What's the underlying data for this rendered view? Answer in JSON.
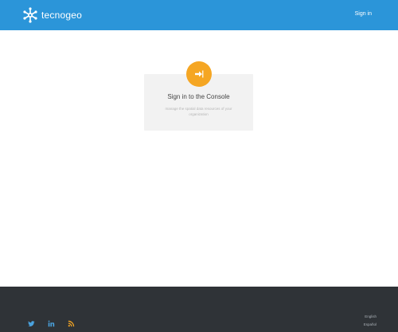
{
  "header": {
    "brand": "tecnogeo",
    "signin_link": "Sign in"
  },
  "card": {
    "title": "Sign in to the Console",
    "subtitle": "manage the spatial data resources of your organization"
  },
  "footer": {
    "social": [
      "twitter-icon",
      "linkedin-icon",
      "rss-icon"
    ],
    "languages": [
      "English",
      "Español"
    ]
  },
  "colors": {
    "header_bg": "#2b95d9",
    "accent": "#f5a623",
    "footer_bg": "#2f3337"
  }
}
